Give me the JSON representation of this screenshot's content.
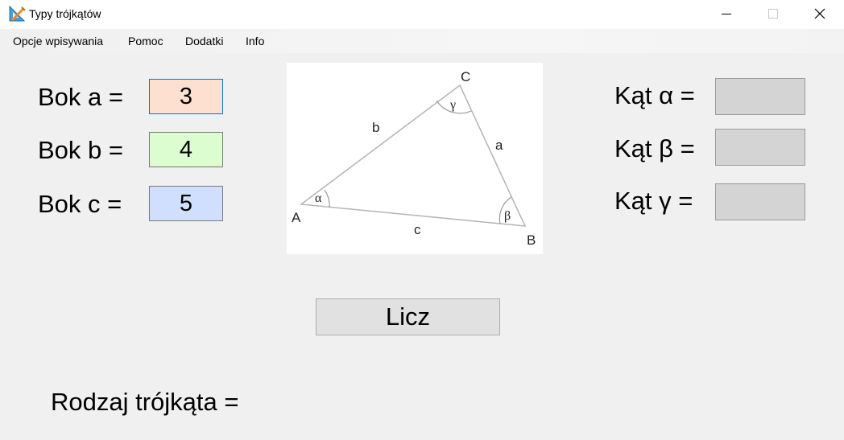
{
  "window": {
    "title": "Typy trójkątów",
    "controls": {
      "minimize": "minimize",
      "maximize": "maximize",
      "close": "close"
    }
  },
  "menu": {
    "items": [
      "Opcje wpisywania",
      "Pomoc",
      "Dodatki",
      "Info"
    ]
  },
  "sides": [
    {
      "label": "Bok a =",
      "value": "3",
      "color": "#fde0cf"
    },
    {
      "label": "Bok b =",
      "value": "4",
      "color": "#dcfdcf"
    },
    {
      "label": "Bok c =",
      "value": "5",
      "color": "#cfdffd"
    }
  ],
  "angles": [
    {
      "label": "Kąt α =",
      "value": ""
    },
    {
      "label": "Kąt β =",
      "value": ""
    },
    {
      "label": "Kąt γ =",
      "value": ""
    }
  ],
  "diagram": {
    "vertices": [
      "A",
      "B",
      "C"
    ],
    "sides": [
      "a",
      "b",
      "c"
    ],
    "angles": [
      "α",
      "β",
      "γ"
    ]
  },
  "calculate_button": "Licz",
  "result": {
    "label": "Rodzaj trójkąta  =",
    "value": ""
  },
  "colors": {
    "input_border_focused": "#0078d7",
    "output_bg": "#d4d4d4"
  }
}
